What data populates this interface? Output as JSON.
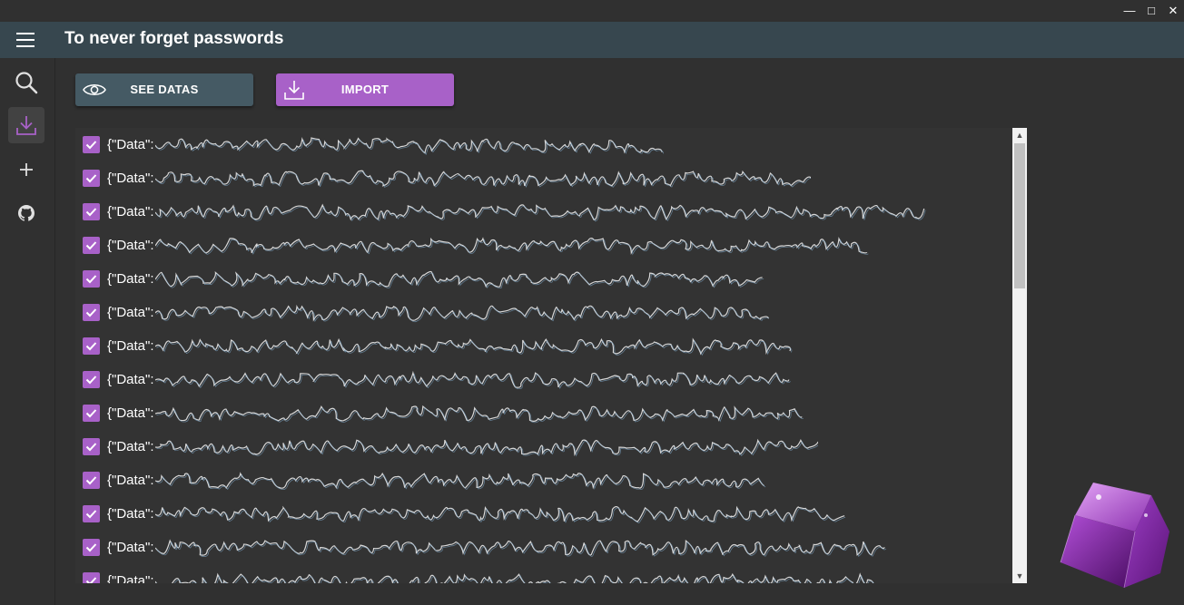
{
  "window": {
    "minimize_glyph": "—",
    "maximize_glyph": "□",
    "close_glyph": "✕"
  },
  "app": {
    "title": "To never forget passwords"
  },
  "rail": {
    "icons": [
      "search-icon",
      "download-icon",
      "plus-icon",
      "github-icon"
    ],
    "active": "download-icon"
  },
  "toolbar": {
    "see_label": "SEE DATAS",
    "import_label": "IMPORT"
  },
  "list": {
    "items": [
      {
        "prefix": "{\"Data\":",
        "checked": true
      },
      {
        "prefix": "{\"Data\":",
        "checked": true
      },
      {
        "prefix": "{\"Data\":",
        "checked": true
      },
      {
        "prefix": "{\"Data\":",
        "checked": true
      },
      {
        "prefix": "{\"Data\":",
        "checked": true
      },
      {
        "prefix": "{\"Data\":",
        "checked": true
      },
      {
        "prefix": "{\"Data\":",
        "checked": true
      },
      {
        "prefix": "{\"Data\":",
        "checked": true
      },
      {
        "prefix": "{\"Data\":",
        "checked": true
      },
      {
        "prefix": "{\"Data\":",
        "checked": true
      },
      {
        "prefix": "{\"Data\":",
        "checked": true
      },
      {
        "prefix": "{\"Data\":",
        "checked": true
      },
      {
        "prefix": "{\"Data\":",
        "checked": true
      },
      {
        "prefix": "{\"Data\":",
        "checked": true
      }
    ]
  },
  "colors": {
    "accent": "#a861c8",
    "appbar": "#37474f",
    "background": "#303030",
    "secondary_button": "#455a64"
  }
}
